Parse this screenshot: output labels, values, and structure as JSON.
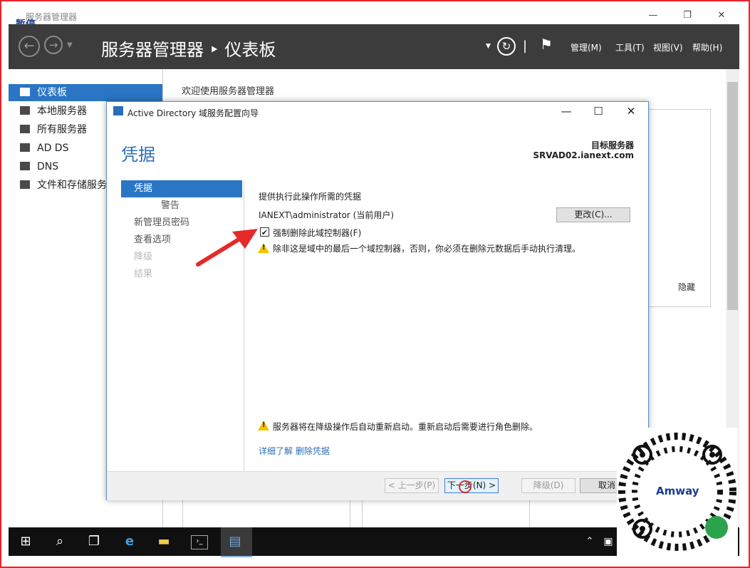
{
  "window": {
    "title": "服务器管理器",
    "pause_label": "暂停",
    "header_title": "服务器管理器 ‣ 仪表板",
    "menu": [
      "管理(M)",
      "工具(T)",
      "视图(V)",
      "帮助(H)"
    ]
  },
  "sidebar": {
    "items": [
      {
        "label": "仪表板"
      },
      {
        "label": "本地服务器"
      },
      {
        "label": "所有服务器"
      },
      {
        "label": "AD DS"
      },
      {
        "label": "DNS"
      },
      {
        "label": "文件和存储服务"
      }
    ]
  },
  "main": {
    "welcome": "欢迎使用服务器管理器",
    "hide_label": "隐藏"
  },
  "dialog": {
    "title": "Active Directory 域服务配置向导",
    "heading": "凭据",
    "target_label": "目标服务器",
    "target_value": "SRVAD02.ianext.com",
    "steps": [
      {
        "label": "凭据"
      },
      {
        "label": "警告"
      },
      {
        "label": "新管理员密码"
      },
      {
        "label": "查看选项"
      },
      {
        "label": "降级"
      },
      {
        "label": "结果"
      }
    ],
    "credential_prompt": "提供执行此操作所需的凭据",
    "current_user": "IANEXT\\administrator (当前用户)",
    "change_button": "更改(C)...",
    "force_checkbox_label": "强制删除此域控制器(F)",
    "force_checked": true,
    "warning_text": "除非这是域中的最后一个域控制器，否则，你必须在删除元数据后手动执行清理。",
    "restart_warning": "服务器将在降级操作后自动重新启动。重新启动后需要进行角色删除。",
    "more_info_link": "详细了解 删除凭据",
    "buttons": {
      "prev": "< 上一步(P)",
      "next": "下一步(N) >",
      "demote": "降级(D)",
      "cancel": "取消"
    }
  },
  "qr": {
    "brand": "Amway"
  }
}
